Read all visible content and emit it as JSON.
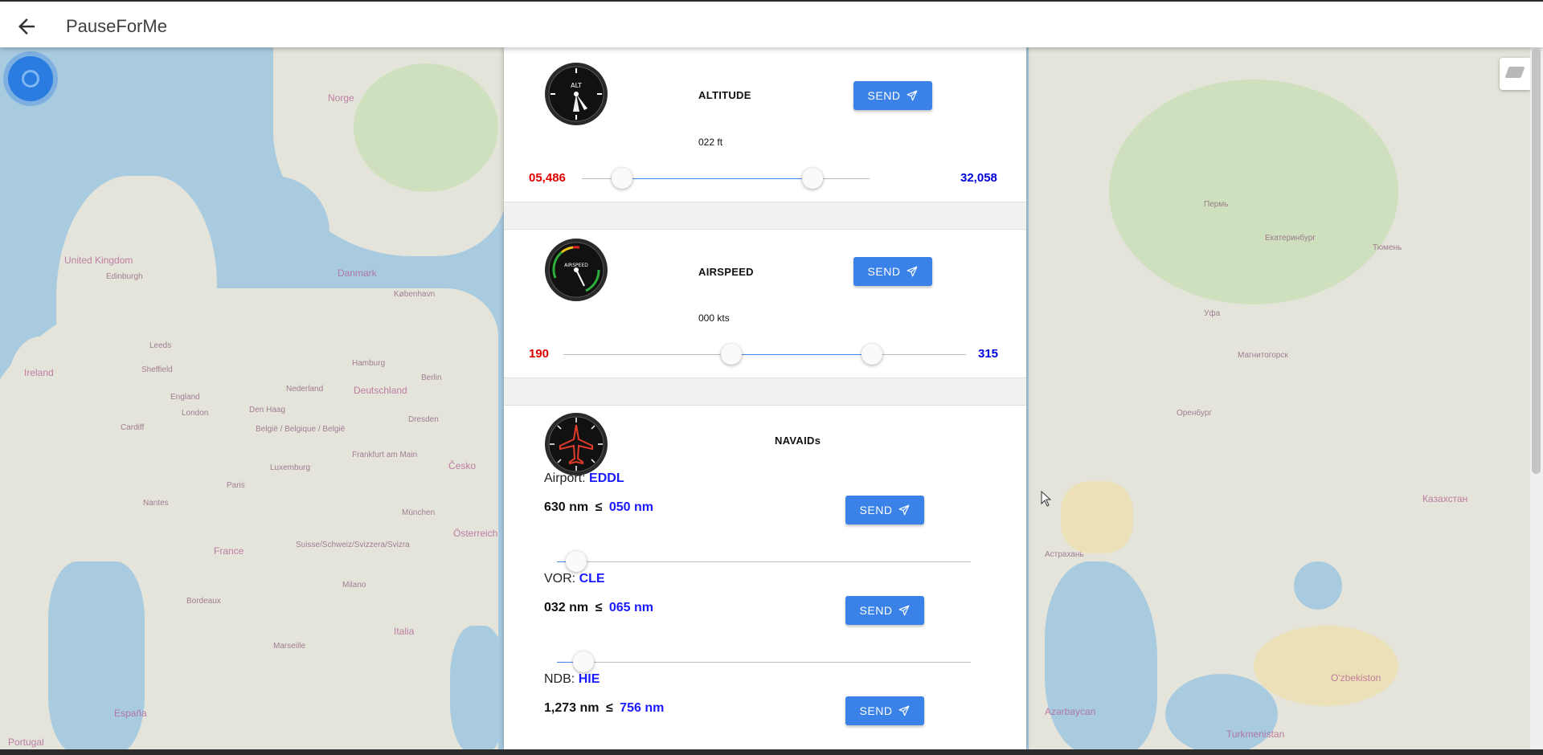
{
  "app": {
    "title": "PauseForMe"
  },
  "icons": {
    "back": "arrow-left-icon",
    "send": "paper-plane-icon",
    "locate": "locate-icon",
    "layers": "layers-icon"
  },
  "colors": {
    "accent": "#3b82e8",
    "min_value": "#e10000",
    "max_value": "#0000dd"
  },
  "map_labels": [
    "Norge",
    "United Kingdom",
    "Edinburgh",
    "Leeds",
    "Sheffield",
    "Ireland",
    "England",
    "Cardiff",
    "London",
    "Danmark",
    "København",
    "Hamburg",
    "Deutschland",
    "Berlin",
    "Den Haag",
    "Nederland",
    "België / Belgique / België",
    "Luxemburg",
    "Frankfurt am Main",
    "Dresden",
    "Česko",
    "Paris",
    "France",
    "Nantes",
    "München",
    "Österreich",
    "Suisse/Schweiz/Svizzera/Svizra",
    "Bordeaux",
    "Milano",
    "Italia",
    "Marseille",
    "España",
    "Portugal",
    "Пермь",
    "Екатеринбург",
    "Тюмень",
    "Уфа",
    "Магнитогорск",
    "Оренбург",
    "Астрахань",
    "Казахстан",
    "O'zbekiston",
    "Turkmenistan",
    "Azərbaycan"
  ],
  "altitude": {
    "title": "ALTITUDE",
    "value": "022 ft",
    "min": "05,486",
    "max": "32,058",
    "send_label": "SEND",
    "range_fraction": [
      0.139,
      0.802
    ]
  },
  "airspeed": {
    "title": "AIRSPEED",
    "value": "000 kts",
    "min": "190",
    "max": "315",
    "send_label": "SEND",
    "range_fraction": [
      0.417,
      0.767
    ]
  },
  "navaids": {
    "title": "NAVAIDs",
    "items": [
      {
        "type": "Airport:",
        "id": "EDDL",
        "current": "630 nm",
        "sep": "≤",
        "max": "050 nm",
        "send_label": "SEND",
        "slider_fraction": 0.047
      },
      {
        "type": "VOR:",
        "id": "CLE",
        "current": "032 nm",
        "sep": "≤",
        "max": "065 nm",
        "send_label": "SEND",
        "slider_fraction": 0.064
      },
      {
        "type": "NDB:",
        "id": "HIE",
        "current": "1,273 nm",
        "sep": "≤",
        "max": "756 nm",
        "send_label": "SEND"
      }
    ]
  }
}
